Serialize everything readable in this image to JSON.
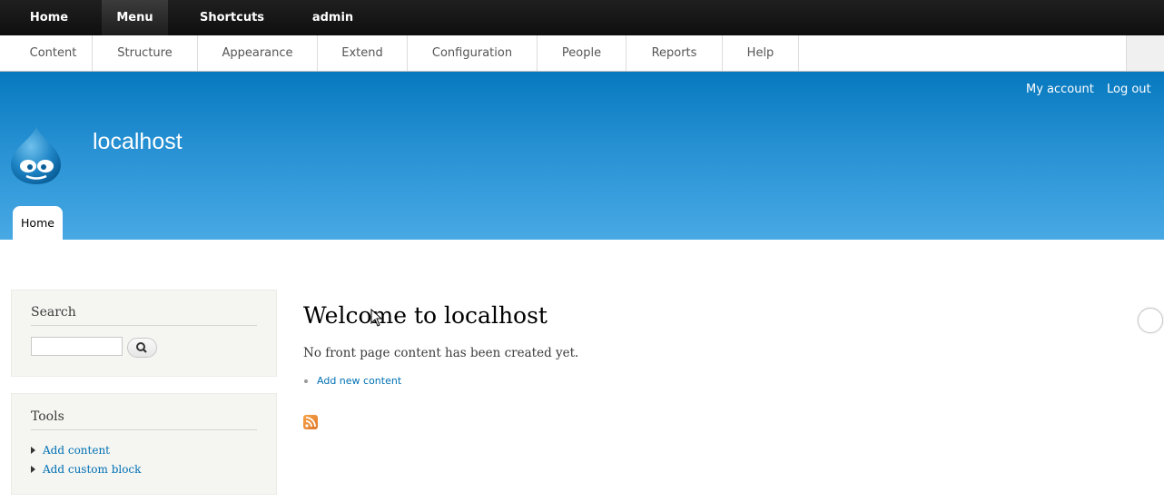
{
  "toolbar": {
    "items": [
      {
        "label": "Home"
      },
      {
        "label": "Menu"
      },
      {
        "label": "Shortcuts"
      },
      {
        "label": "admin"
      }
    ]
  },
  "tray": {
    "items": [
      {
        "label": "Content"
      },
      {
        "label": "Structure"
      },
      {
        "label": "Appearance"
      },
      {
        "label": "Extend"
      },
      {
        "label": "Configuration"
      },
      {
        "label": "People"
      },
      {
        "label": "Reports"
      },
      {
        "label": "Help"
      }
    ]
  },
  "header": {
    "secondary_menu": {
      "my_account": "My account",
      "log_out": "Log out"
    },
    "site_name": "localhost",
    "logo_icon": "drupal-drop-icon",
    "tab_home": "Home",
    "colors": {
      "gradient_top": "#0779bf",
      "gradient_bottom": "#48a9e4"
    }
  },
  "sidebar": {
    "search": {
      "title": "Search",
      "placeholder": "",
      "button_icon": "search-icon"
    },
    "tools": {
      "title": "Tools",
      "items": [
        {
          "label": "Add content"
        },
        {
          "label": "Add custom block"
        }
      ]
    }
  },
  "main": {
    "title": "Welcome to localhost",
    "message": "No front page content has been created yet.",
    "add_link": "Add new content",
    "feed_icon": "rss-icon"
  }
}
